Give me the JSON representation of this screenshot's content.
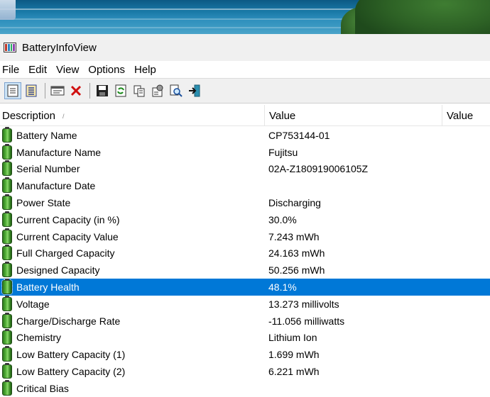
{
  "window": {
    "title": "BatteryInfoView"
  },
  "menu": [
    "File",
    "Edit",
    "View",
    "Options",
    "Help"
  ],
  "toolbar": {
    "buttons": [
      {
        "icon": "html-report-icon",
        "pressed": true
      },
      {
        "icon": "list-view-icon",
        "pressed": false
      },
      {
        "icon": "log-window-icon",
        "pressed": false
      },
      {
        "icon": "delete-icon",
        "pressed": false
      },
      {
        "icon": "save-icon",
        "pressed": false
      },
      {
        "icon": "refresh-icon",
        "pressed": false
      },
      {
        "icon": "copy-icon",
        "pressed": false
      },
      {
        "icon": "properties-icon",
        "pressed": false
      },
      {
        "icon": "find-icon",
        "pressed": false
      },
      {
        "icon": "exit-icon",
        "pressed": false
      }
    ]
  },
  "columns": {
    "description": "Description",
    "value": "Value",
    "value2": "Value"
  },
  "rows": [
    {
      "description": "Battery Name",
      "value": "CP753144-01"
    },
    {
      "description": "Manufacture Name",
      "value": "Fujitsu"
    },
    {
      "description": "Serial Number",
      "value": "02A-Z180919006105Z"
    },
    {
      "description": "Manufacture Date",
      "value": ""
    },
    {
      "description": "Power State",
      "value": "Discharging"
    },
    {
      "description": "Current Capacity (in %)",
      "value": "30.0%"
    },
    {
      "description": "Current Capacity Value",
      "value": "7.243 mWh"
    },
    {
      "description": "Full Charged Capacity",
      "value": "24.163 mWh"
    },
    {
      "description": "Designed Capacity",
      "value": "50.256 mWh"
    },
    {
      "description": "Battery Health",
      "value": "48.1%",
      "selected": true
    },
    {
      "description": "Voltage",
      "value": "13.273 millivolts"
    },
    {
      "description": "Charge/Discharge Rate",
      "value": "-11.056 milliwatts"
    },
    {
      "description": "Chemistry",
      "value": "Lithium Ion"
    },
    {
      "description": "Low Battery Capacity (1)",
      "value": "1.699 mWh"
    },
    {
      "description": "Low Battery Capacity (2)",
      "value": "6.221 mWh"
    },
    {
      "description": "Critical Bias",
      "value": ""
    }
  ],
  "colors": {
    "selection": "#0078d7",
    "toolbar_bg": "#f0f0f0"
  }
}
